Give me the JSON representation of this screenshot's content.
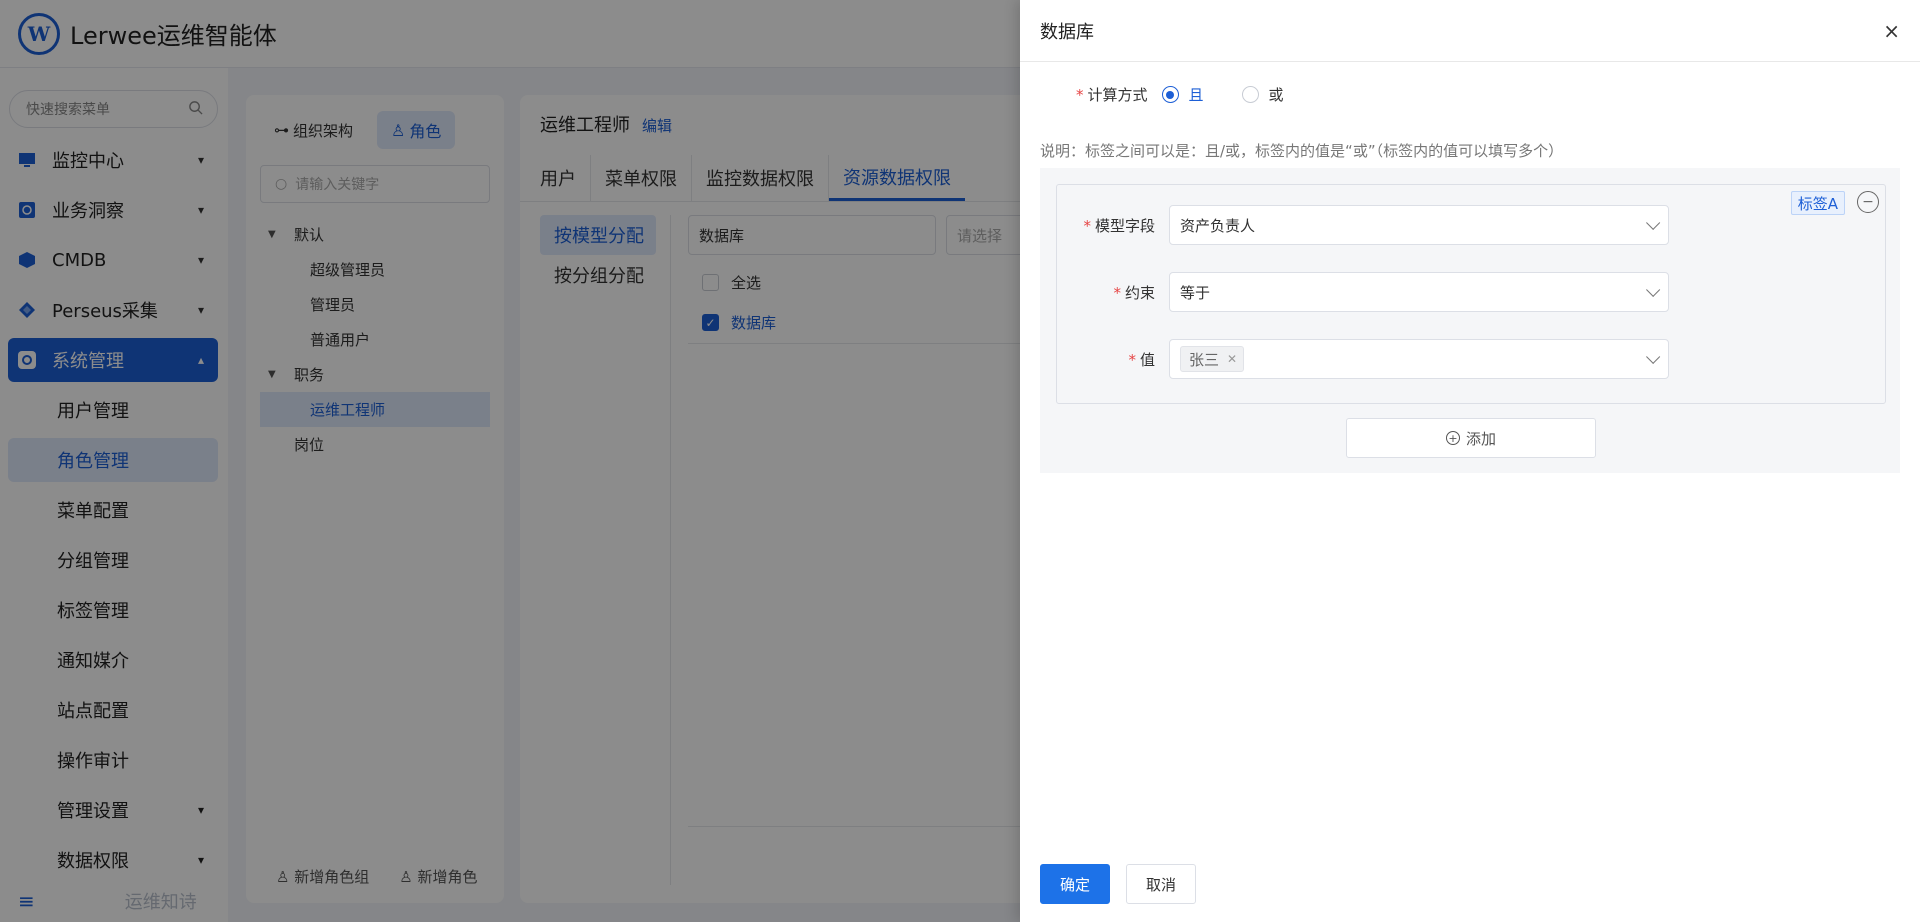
{
  "app": {
    "logo_letter": "W",
    "title": "Lerwee运维智能体"
  },
  "sidebar": {
    "search_placeholder": "快速搜索菜单",
    "items": [
      {
        "label": "监控中心",
        "icon": "monitor-icon"
      },
      {
        "label": "业务洞察",
        "icon": "insight-icon"
      },
      {
        "label": "CMDB",
        "icon": "cube-icon"
      },
      {
        "label": "Perseus采集",
        "icon": "diamond-icon"
      },
      {
        "label": "系统管理",
        "icon": "gear-icon"
      }
    ],
    "sub_items": [
      "用户管理",
      "角色管理",
      "菜单配置",
      "分组管理",
      "标签管理",
      "通知媒介",
      "站点配置",
      "操作审计",
      "管理设置",
      "数据权限"
    ],
    "footer_text": "运维知诗"
  },
  "org": {
    "tab_org": "组织架构",
    "tab_role": "角色",
    "search_placeholder": "请输入关键字",
    "tree": {
      "group1": "默认",
      "group1_children": [
        "超级管理员",
        "管理员",
        "普通用户"
      ],
      "group2": "职务",
      "group2_children": [
        "运维工程师"
      ],
      "group3": "岗位"
    },
    "add_group": "新增角色组",
    "add_role": "新增角色"
  },
  "role": {
    "name": "运维工程师",
    "edit": "编辑",
    "tabs": [
      "用户",
      "菜单权限",
      "监控数据权限",
      "资源数据权限"
    ],
    "assign": [
      "按模型分配",
      "按分组分配"
    ],
    "resource_select": "数据库",
    "resource_placeholder": "请选择",
    "select_all": "全选",
    "checked_item": "数据库"
  },
  "drawer": {
    "title": "数据库",
    "close": "×",
    "calc_label": "计算方式",
    "calc_options": [
      "且",
      "或"
    ],
    "calc_selected": "且",
    "note": "说明：标签之间可以是：且/或，标签内的值是“或”（标签内的值可以填写多个）",
    "condition": {
      "tag": "标签A",
      "field_label": "模型字段",
      "field_value": "资产负责人",
      "constraint_label": "约束",
      "constraint_value": "等于",
      "value_label": "值",
      "value_chips": [
        "张三"
      ]
    },
    "add_label": "添加",
    "confirm": "确定",
    "cancel": "取消"
  },
  "colors": {
    "primary": "#1d5fd6",
    "button_primary": "#1d72e8",
    "required": "#e64545"
  }
}
